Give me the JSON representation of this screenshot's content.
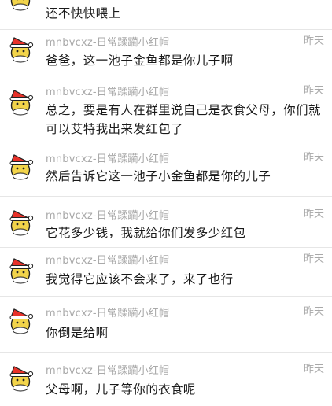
{
  "messages": [
    {
      "sender": "",
      "time": "",
      "text": "还不快快喂上"
    },
    {
      "sender": "mnbvcxz-日常蹂躏小红帽",
      "time": "昨天",
      "text": "爸爸，这一池子金鱼都是你儿子啊"
    },
    {
      "sender": "mnbvcxz-日常蹂躏小红帽",
      "time": "昨天",
      "text": "总之，要是有人在群里说自己是衣食父母，你们就可以艾特我出来发红包了"
    },
    {
      "sender": "mnbvcxz-日常蹂躏小红帽",
      "time": "昨天",
      "text": "然后告诉它这一池子小金鱼都是你的儿子"
    },
    {
      "sender": "mnbvcxz-日常蹂躏小红帽",
      "time": "昨天",
      "text": "它花多少钱，我就给你们发多少红包"
    },
    {
      "sender": "mnbvcxz-日常蹂躏小红帽",
      "time": "昨天",
      "text": "我觉得它应该不会来了，来了也行"
    },
    {
      "sender": "mnbvcxz-日常蹂躏小红帽",
      "time": "昨天",
      "text": "你倒是给啊"
    },
    {
      "sender": "mnbvcxz-日常蹂躏小红帽",
      "time": "昨天",
      "text": "父母啊，儿子等你的衣食呢"
    }
  ],
  "colors": {
    "hat": "#e8322a",
    "face": "#f2d44a",
    "text": "#1a1a1a",
    "meta": "#a9a9a9",
    "divider": "#e6e6e6"
  },
  "icons": {
    "avatar": "santa-hat-emoji-avatar-icon"
  }
}
